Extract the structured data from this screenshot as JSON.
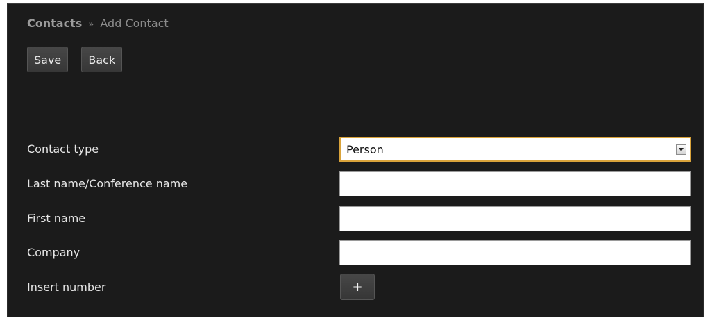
{
  "breadcrumb": {
    "link": "Contacts",
    "separator": "»",
    "current": "Add Contact"
  },
  "toolbar": {
    "save_label": "Save",
    "back_label": "Back"
  },
  "form": {
    "contact_type": {
      "label": "Contact type",
      "value": "Person",
      "icon": "chevron-down-icon"
    },
    "last_name": {
      "label": "Last name/Conference name",
      "value": ""
    },
    "first_name": {
      "label": "First name",
      "value": ""
    },
    "company": {
      "label": "Company",
      "value": ""
    },
    "insert_number": {
      "label": "Insert number",
      "button_label": "+"
    }
  },
  "colors": {
    "background": "#1b1b1b",
    "focus_border": "#d9a33b",
    "button_bg": "#404040",
    "label_text": "#e6e6e6"
  }
}
